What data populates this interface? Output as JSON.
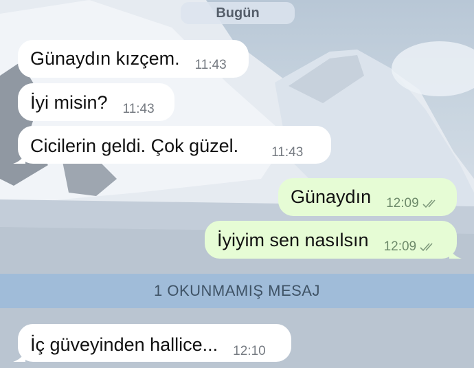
{
  "date_separator": "Bugün",
  "messages": [
    {
      "text": "Günaydın kızçem.",
      "time": "11:43",
      "direction": "incoming"
    },
    {
      "text": "İyi misin?",
      "time": "11:43",
      "direction": "incoming"
    },
    {
      "text": "Cicilerin geldi. Çok güzel.",
      "time": "11:43",
      "direction": "incoming"
    },
    {
      "text": "Günaydın",
      "time": "12:09",
      "direction": "outgoing",
      "status": "read"
    },
    {
      "text": "İyiyim sen nasılsın",
      "time": "12:09",
      "direction": "outgoing",
      "status": "read"
    }
  ],
  "unread_separator": "1 OKUNMAMIŞ MESAJ",
  "unread_messages": [
    {
      "text": "İç güveyinden hallice...",
      "time": "12:10",
      "direction": "incoming"
    }
  ],
  "colors": {
    "incoming_bubble": "#ffffff",
    "outgoing_bubble": "#e6fcd5",
    "unread_bar": "#96b9dc"
  }
}
